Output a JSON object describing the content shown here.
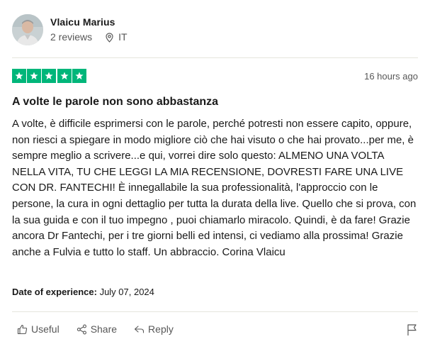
{
  "reviewer": {
    "name": "Vlaicu Marius",
    "reviews_count": "2 reviews",
    "country": "IT",
    "avatar_icon": "avatar-photo"
  },
  "review": {
    "rating": 5,
    "rating_max": 5,
    "star_color": "#00b67a",
    "posted": "16 hours ago",
    "title": "A volte le parole non sono abbastanza",
    "body": "A volte, è difficile esprimersi con le parole, perché potresti non essere capito, oppure, non riesci a spiegare in modo migliore ciò che hai visuto o che hai provato...per me, è sempre meglio a scrivere...e qui, vorrei dire solo questo: ALMENO UNA VOLTA NELLA VITA, TU CHE LEGGI LA MIA RECENSIONE, DOVRESTI FARE UNA LIVE CON DR. FANTECHI! È innegallabile la sua professionalità, l'approccio con le persone, la cura in ogni dettaglio per tutta la durata della live. Quello che si prova, con la sua guida e con il tuo impegno , puoi chiamarlo miracolo. Quindi, è da fare! Grazie ancora Dr Fantechi, per i tre giorni belli ed intensi, ci vediamo alla prossima! Grazie anche a Fulvia e tutto lo staff. Un abbraccio. Corina Vlaicu",
    "experience_label": "Date of experience:",
    "experience_date": "July 07, 2024"
  },
  "actions": {
    "useful": "Useful",
    "share": "Share",
    "reply": "Reply",
    "icons": [
      "thumbs-up-icon",
      "share-icon",
      "reply-icon",
      "flag-icon"
    ]
  }
}
